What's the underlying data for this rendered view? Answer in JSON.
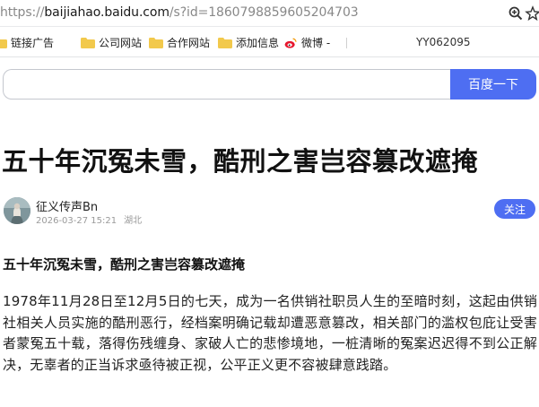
{
  "browser": {
    "url_scheme": "https://",
    "url_host": "baijiahao.baidu.com",
    "url_path": "/s?id=1860798859605204703",
    "icons": [
      "zoom-icon",
      "star-icon"
    ]
  },
  "bookmarks": {
    "items": [
      {
        "label": "链接广告",
        "icon": "folder-icon"
      },
      {
        "label": "公司网站",
        "icon": "folder-icon"
      },
      {
        "label": "合作网站",
        "icon": "folder-icon"
      },
      {
        "label": "添加信息",
        "icon": "folder-icon"
      },
      {
        "label": "微博 -",
        "icon": "weibo-icon"
      }
    ],
    "right_text": "YY062095"
  },
  "search": {
    "value": "",
    "button_label": "百度一下"
  },
  "article": {
    "title": "五十年沉冤未雪，酷刑之害岂容篡改遮掩",
    "author": {
      "name": "征义传声Bn",
      "datetime": "2026-03-27 15:21",
      "location": "湖北",
      "follow_label": "关注"
    },
    "subtitle": "五十年沉冤未雪，酷刑之害岂容篡改遮掩",
    "paragraph": "1978年11月28日至12月5日的七天，成为一名供销社职员人生的至暗时刻，这起由供销社相关人员实施的酷刑恶行，经档案明确记载却遭恶意篡改，相关部门的滥权包庇让受害者蒙冤五十载，落得伤残缠身、家破人亡的悲惨境地，一桩清晰的冤案迟迟得不到公正解决，无辜者的正当诉求亟待被正视，公平正义更不容被肆意践踏。"
  },
  "colors": {
    "accent": "#4e6ef2",
    "folder": "#f2c94c"
  }
}
